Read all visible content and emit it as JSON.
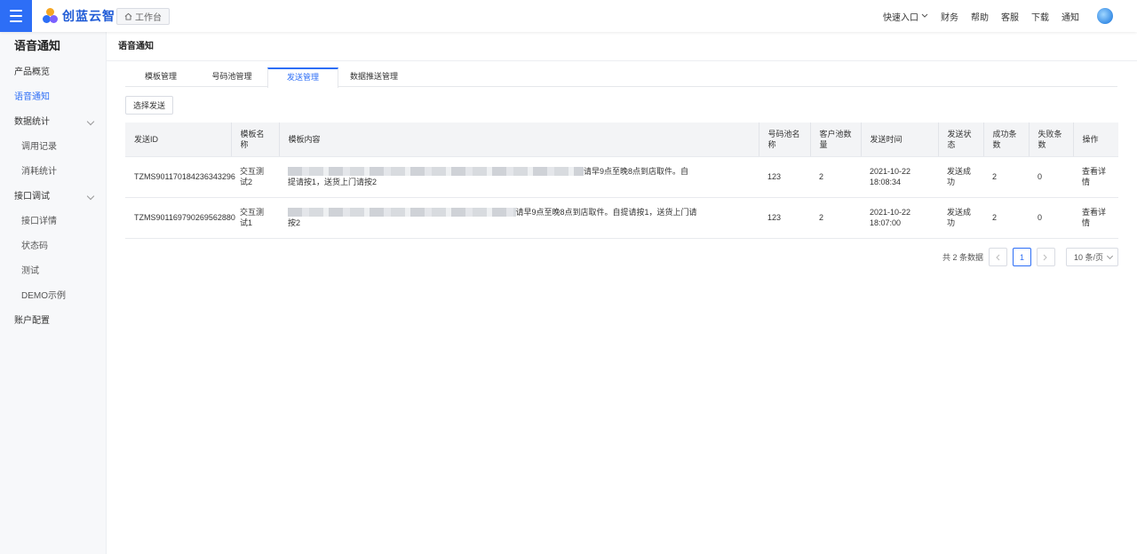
{
  "header": {
    "brand": "创蓝云智",
    "workbench_label": "工作台",
    "quick_entry": "快速入口",
    "nav": [
      "财务",
      "帮助",
      "客服",
      "下载",
      "通知"
    ]
  },
  "sidebar": {
    "title": "语音通知",
    "items": [
      {
        "label": "产品概览"
      },
      {
        "label": "语音通知"
      },
      {
        "label": "数据统计"
      },
      {
        "label": "调用记录"
      },
      {
        "label": "消耗统计"
      },
      {
        "label": "接口调试"
      },
      {
        "label": "接口详情"
      },
      {
        "label": "状态码"
      },
      {
        "label": "测试"
      },
      {
        "label": "DEMO示例"
      },
      {
        "label": "账户配置"
      }
    ]
  },
  "main": {
    "page_title": "语音通知",
    "tabs": [
      "模板管理",
      "号码池管理",
      "发送管理",
      "数据推送管理"
    ],
    "active_tab": "发送管理",
    "select_send_button": "选择发送",
    "table": {
      "columns": [
        "发送ID",
        "模板名称",
        "模板内容",
        "号码池名称",
        "客户池数量",
        "发送时间",
        "发送状态",
        "成功条数",
        "失败条数",
        "操作"
      ],
      "rows": [
        {
          "id": "TZMS901170184236343296",
          "template_name": "交互测试2",
          "content_visible_line1": "请早9点至晚8点到店取件。自",
          "content_visible_line2": "提请按1，送货上门请按2",
          "pool_name": "123",
          "customer_count": "2",
          "send_time": "2021-10-22 18:08:34",
          "status": "发送成功",
          "success": "2",
          "fail": "0",
          "action": "查看详情"
        },
        {
          "id": "TZMS901169790269562880",
          "template_name": "交互测试1",
          "content_visible_line1": "请早9点至晚8点到店取件。自提请按1，送货上门请",
          "content_visible_line2": "按2",
          "pool_name": "123",
          "customer_count": "2",
          "send_time": "2021-10-22 18:07:00",
          "status": "发送成功",
          "success": "2",
          "fail": "0",
          "action": "查看详情"
        }
      ]
    },
    "pagination": {
      "total_text": "共 2 条数据",
      "current_page": "1",
      "page_size": "10 条/页"
    }
  },
  "colors": {
    "accent": "#2d6ef6",
    "sidebar_bg": "#f7f8fa",
    "header_cell_bg": "#f3f4f6"
  }
}
